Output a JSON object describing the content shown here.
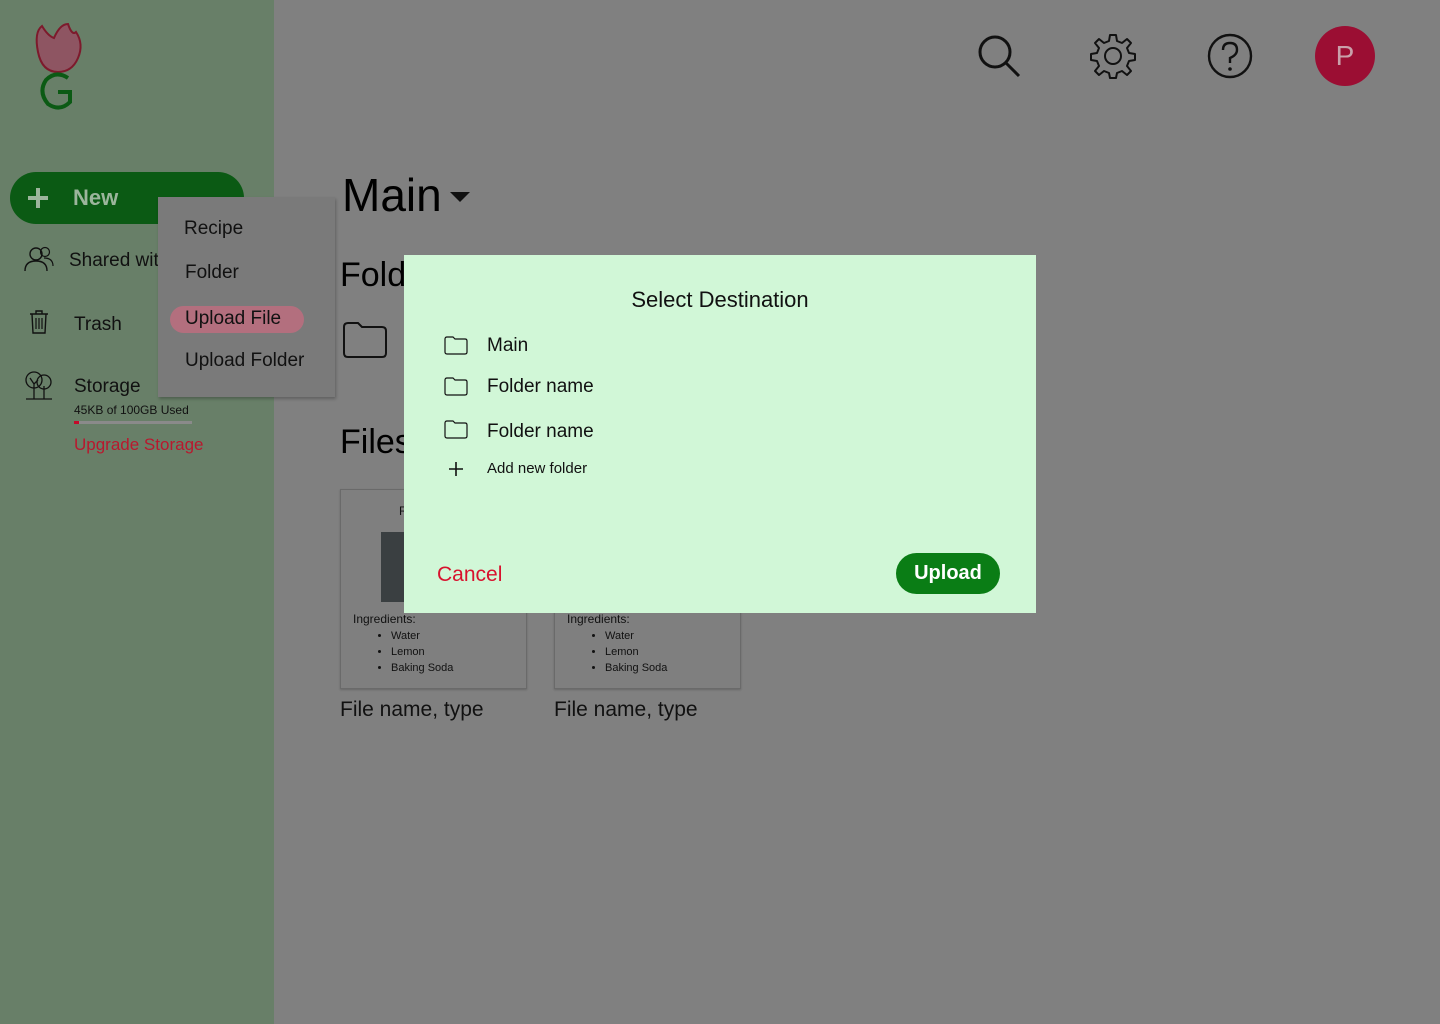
{
  "sidebar": {
    "new_label": "New",
    "items": [
      {
        "label": "Shared with me",
        "icon": "people-icon"
      },
      {
        "label": "Trash",
        "icon": "trash-icon"
      },
      {
        "label": "Storage",
        "icon": "tree-icon"
      }
    ],
    "storage_used_text": "45KB of 100GB Used",
    "storage_used_fraction": 0.045,
    "upgrade_label": "Upgrade Storage"
  },
  "new_menu": {
    "items": [
      "Recipe",
      "Folder",
      "Upload File",
      "Upload Folder"
    ],
    "highlighted": "Upload File"
  },
  "header": {
    "icons": [
      "search-icon",
      "gear-icon",
      "help-icon"
    ],
    "avatar_initial": "P"
  },
  "main": {
    "title": "Main",
    "folders_heading": "Folders",
    "files_heading": "Files",
    "cards": [
      {
        "title": "R",
        "ingredients_label": "Ingredients:",
        "ingredients": [
          "Water",
          "Lemon",
          "Baking Soda"
        ],
        "caption": "File name, type"
      },
      {
        "title": "",
        "ingredients_label": "Ingredients:",
        "ingredients": [
          "Water",
          "Lemon",
          "Baking Soda"
        ],
        "caption": "File name, type"
      }
    ]
  },
  "modal": {
    "title": "Select Destination",
    "destinations": [
      "Main",
      "Folder name",
      "Folder name"
    ],
    "add_folder_label": "Add new folder",
    "cancel_label": "Cancel",
    "upload_label": "Upload"
  },
  "colors": {
    "sidebar_bg": "#687f68",
    "overlay_bg": "#808080",
    "new_button": "#0b5a14",
    "modal_bg": "#d1f7d7",
    "upload_button": "#0a7d15",
    "cancel_text": "#d8122e",
    "avatar_bg": "#9b0e33",
    "upgrade_text": "#b9182e"
  }
}
